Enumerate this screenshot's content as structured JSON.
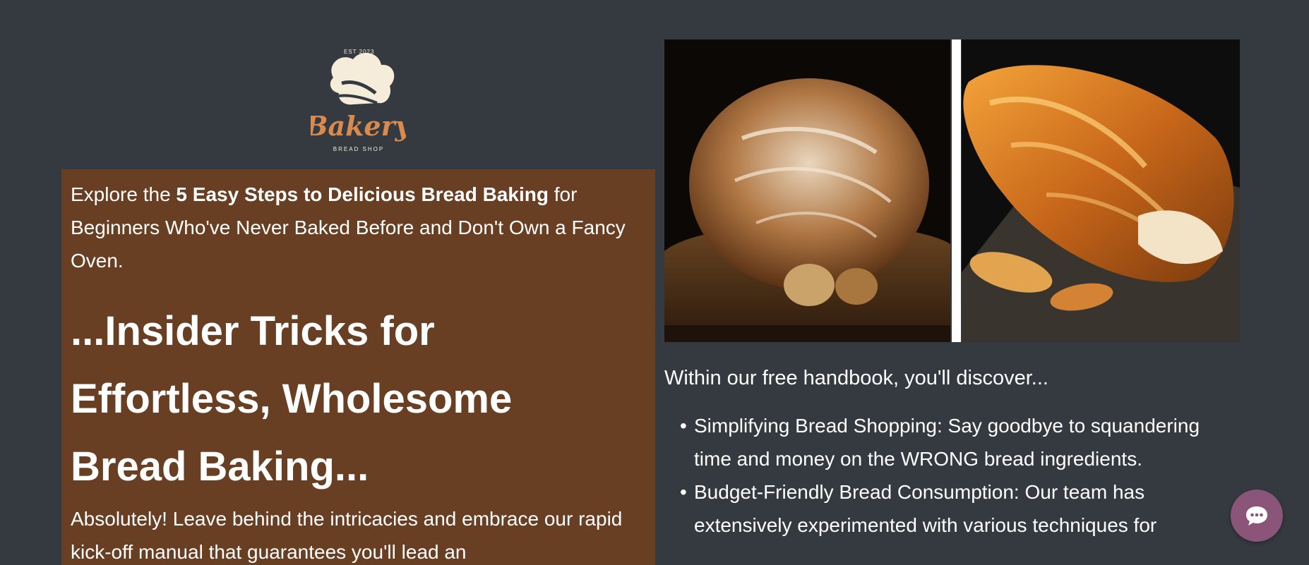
{
  "logo": {
    "est_text": "EST 2023",
    "brand": "Bakery",
    "tagline": "BREAD SHOP"
  },
  "intro": {
    "prefix": "Explore the ",
    "bold": "5 Easy Steps to Delicious Bread Baking",
    "suffix": " for Beginners Who've Never Baked Before and Don't Own a Fancy Oven."
  },
  "headline": "...Insider Tricks for Effortless, Wholesome Bread Baking...",
  "body_text": "Absolutely! Leave behind the intricacies and embrace our rapid kick-off manual that guarantees you'll lead an",
  "handbook": {
    "lead": "Within our free handbook, you'll discover...",
    "items": [
      "Simplifying Bread Shopping: Say goodbye to squandering time and money on the WRONG bread ingredients.",
      "Budget-Friendly Bread Consumption: Our team has extensively experimented with various techniques for"
    ]
  },
  "colors": {
    "background": "#343a40",
    "panel": "#693f24",
    "chat_button": "#8a5579",
    "logo_accent": "#d98a4e",
    "logo_cream": "#f5ecd9"
  },
  "icons": {
    "chat": "chat-bubble-icon"
  }
}
